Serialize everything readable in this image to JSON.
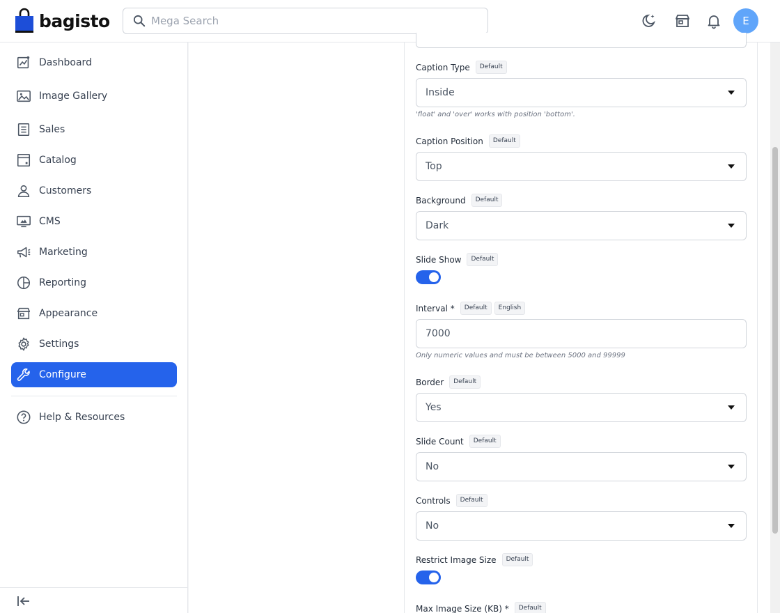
{
  "header": {
    "brand": "bagisto",
    "search_placeholder": "Mega Search",
    "avatar_initial": "E",
    "accent": "#2563eb"
  },
  "sidebar": {
    "items": [
      {
        "label": "Dashboard",
        "icon": "dashboard-icon"
      },
      {
        "label": "Image Gallery",
        "icon": "image-icon"
      },
      {
        "label": "Sales",
        "icon": "sales-icon"
      },
      {
        "label": "Catalog",
        "icon": "catalog-icon"
      },
      {
        "label": "Customers",
        "icon": "customers-icon"
      },
      {
        "label": "CMS",
        "icon": "cms-icon"
      },
      {
        "label": "Marketing",
        "icon": "megaphone-icon"
      },
      {
        "label": "Reporting",
        "icon": "pie-chart-icon"
      },
      {
        "label": "Appearance",
        "icon": "storefront-icon"
      },
      {
        "label": "Settings",
        "icon": "gear-icon"
      },
      {
        "label": "Configure",
        "icon": "wrench-icon",
        "active": true
      }
    ],
    "help": {
      "label": "Help & Resources",
      "icon": "help-icon"
    }
  },
  "form": {
    "caption_type": {
      "label": "Caption Type",
      "badge": "Default",
      "value": "Inside",
      "hint": "'float' and 'over' works with position 'bottom'."
    },
    "caption_position": {
      "label": "Caption Position",
      "badge": "Default",
      "value": "Top"
    },
    "background": {
      "label": "Background",
      "badge": "Default",
      "value": "Dark"
    },
    "slide_show": {
      "label": "Slide Show",
      "badge": "Default",
      "enabled": true
    },
    "interval": {
      "label": "Interval *",
      "badge": "Default",
      "badge2": "English",
      "value": "7000",
      "hint": "Only numeric values and must be between 5000 and 99999"
    },
    "border": {
      "label": "Border",
      "badge": "Default",
      "value": "Yes"
    },
    "slide_count": {
      "label": "Slide Count",
      "badge": "Default",
      "value": "No"
    },
    "controls": {
      "label": "Controls",
      "badge": "Default",
      "value": "No"
    },
    "restrict_image_size": {
      "label": "Restrict Image Size",
      "badge": "Default",
      "enabled": true
    },
    "max_image_size": {
      "label": "Max Image Size (KB) *",
      "badge": "Default"
    }
  }
}
